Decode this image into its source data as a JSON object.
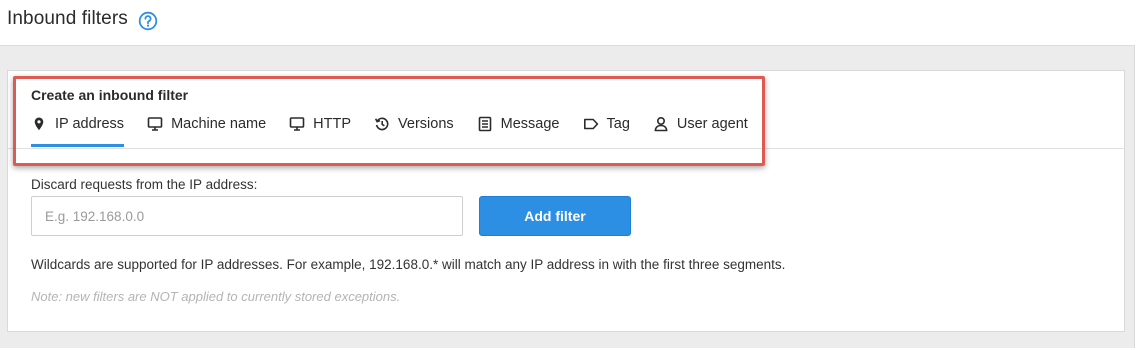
{
  "header": {
    "title": "Inbound filters",
    "help_icon": "help-circle-icon"
  },
  "colors": {
    "accent": "#2f8fe0",
    "button": "#2d8fe4",
    "highlight": "#df5a52"
  },
  "filter_panel": {
    "section_label": "Create an inbound filter",
    "tabs": [
      {
        "label": "IP address",
        "icon": "map-pin-icon",
        "active": true
      },
      {
        "label": "Machine name",
        "icon": "monitor-icon",
        "active": false
      },
      {
        "label": "HTTP",
        "icon": "monitor-icon",
        "active": false
      },
      {
        "label": "Versions",
        "icon": "history-icon",
        "active": false
      },
      {
        "label": "Message",
        "icon": "document-icon",
        "active": false
      },
      {
        "label": "Tag",
        "icon": "tag-icon",
        "active": false
      },
      {
        "label": "User agent",
        "icon": "user-icon",
        "active": false
      }
    ]
  },
  "form": {
    "field_label": "Discard requests from the IP address:",
    "ip_placeholder": "E.g. 192.168.0.0",
    "ip_value": "",
    "add_button_label": "Add filter",
    "hint": "Wildcards are supported for IP addresses. For example, 192.168.0.* will match any IP address in with the first three segments.",
    "note": "Note: new filters are NOT applied to currently stored exceptions."
  }
}
